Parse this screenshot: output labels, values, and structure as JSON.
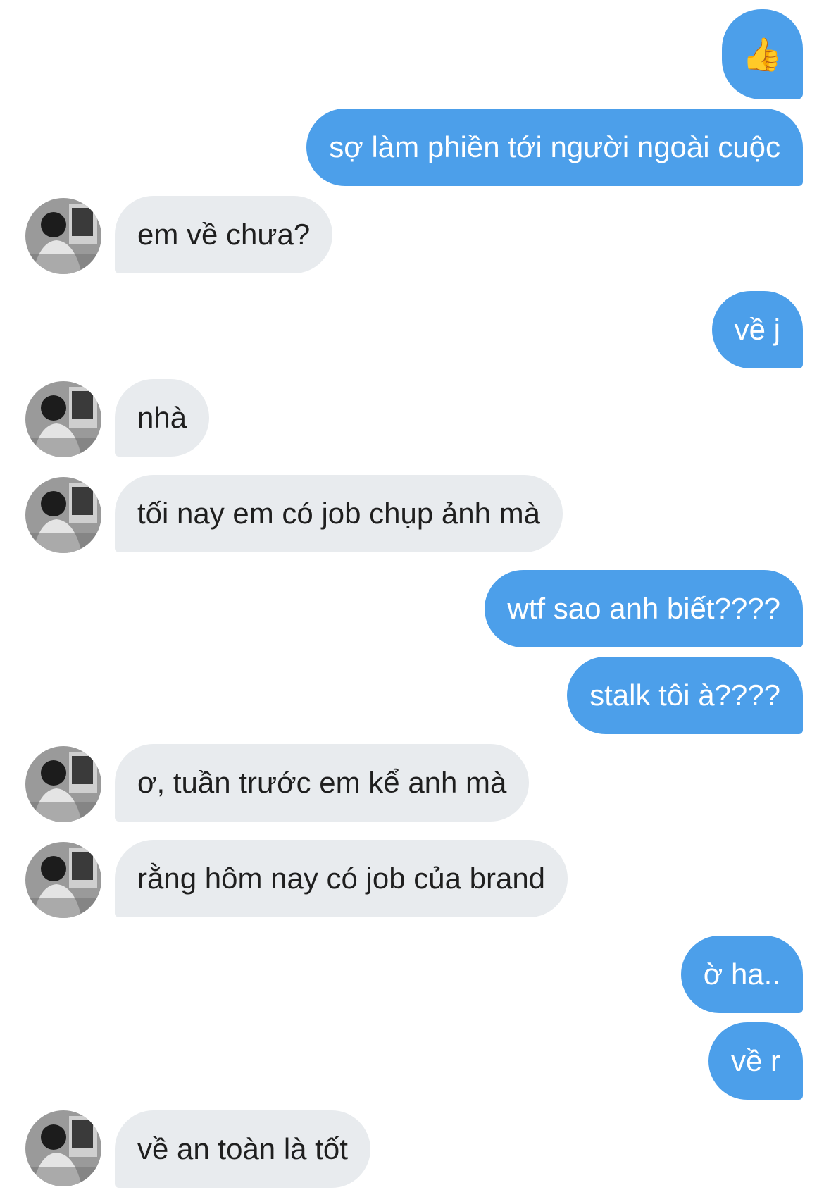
{
  "messages": [
    {
      "side": "out",
      "text": "👍",
      "emoji": true,
      "emoji_name": "thumbs-up-icon"
    },
    {
      "side": "out",
      "text": "sợ làm phiền tới người ngoài cuộc"
    },
    {
      "side": "in",
      "text": "em về chưa?"
    },
    {
      "side": "out",
      "text": "về j"
    },
    {
      "side": "in",
      "text": "nhà"
    },
    {
      "side": "in",
      "text": "tối nay em có job chụp ảnh mà"
    },
    {
      "side": "out",
      "text": "wtf sao anh biết????"
    },
    {
      "side": "out",
      "text": "stalk tôi à????"
    },
    {
      "side": "in",
      "text": "ơ, tuần trước em kể anh mà"
    },
    {
      "side": "in",
      "text": "rằng hôm nay có job của brand"
    },
    {
      "side": "out",
      "text": "ờ ha.."
    },
    {
      "side": "out",
      "text": "về r"
    },
    {
      "side": "in",
      "text": "về an toàn là tốt"
    }
  ],
  "colors": {
    "outgoing_bubble": "#4c9fea",
    "outgoing_text": "#ffffff",
    "incoming_bubble": "#e8ebee",
    "incoming_text": "#1f1f1f",
    "background": "#ffffff"
  },
  "avatar": {
    "icon": "contact-avatar-icon",
    "style": "grayscale photo"
  }
}
